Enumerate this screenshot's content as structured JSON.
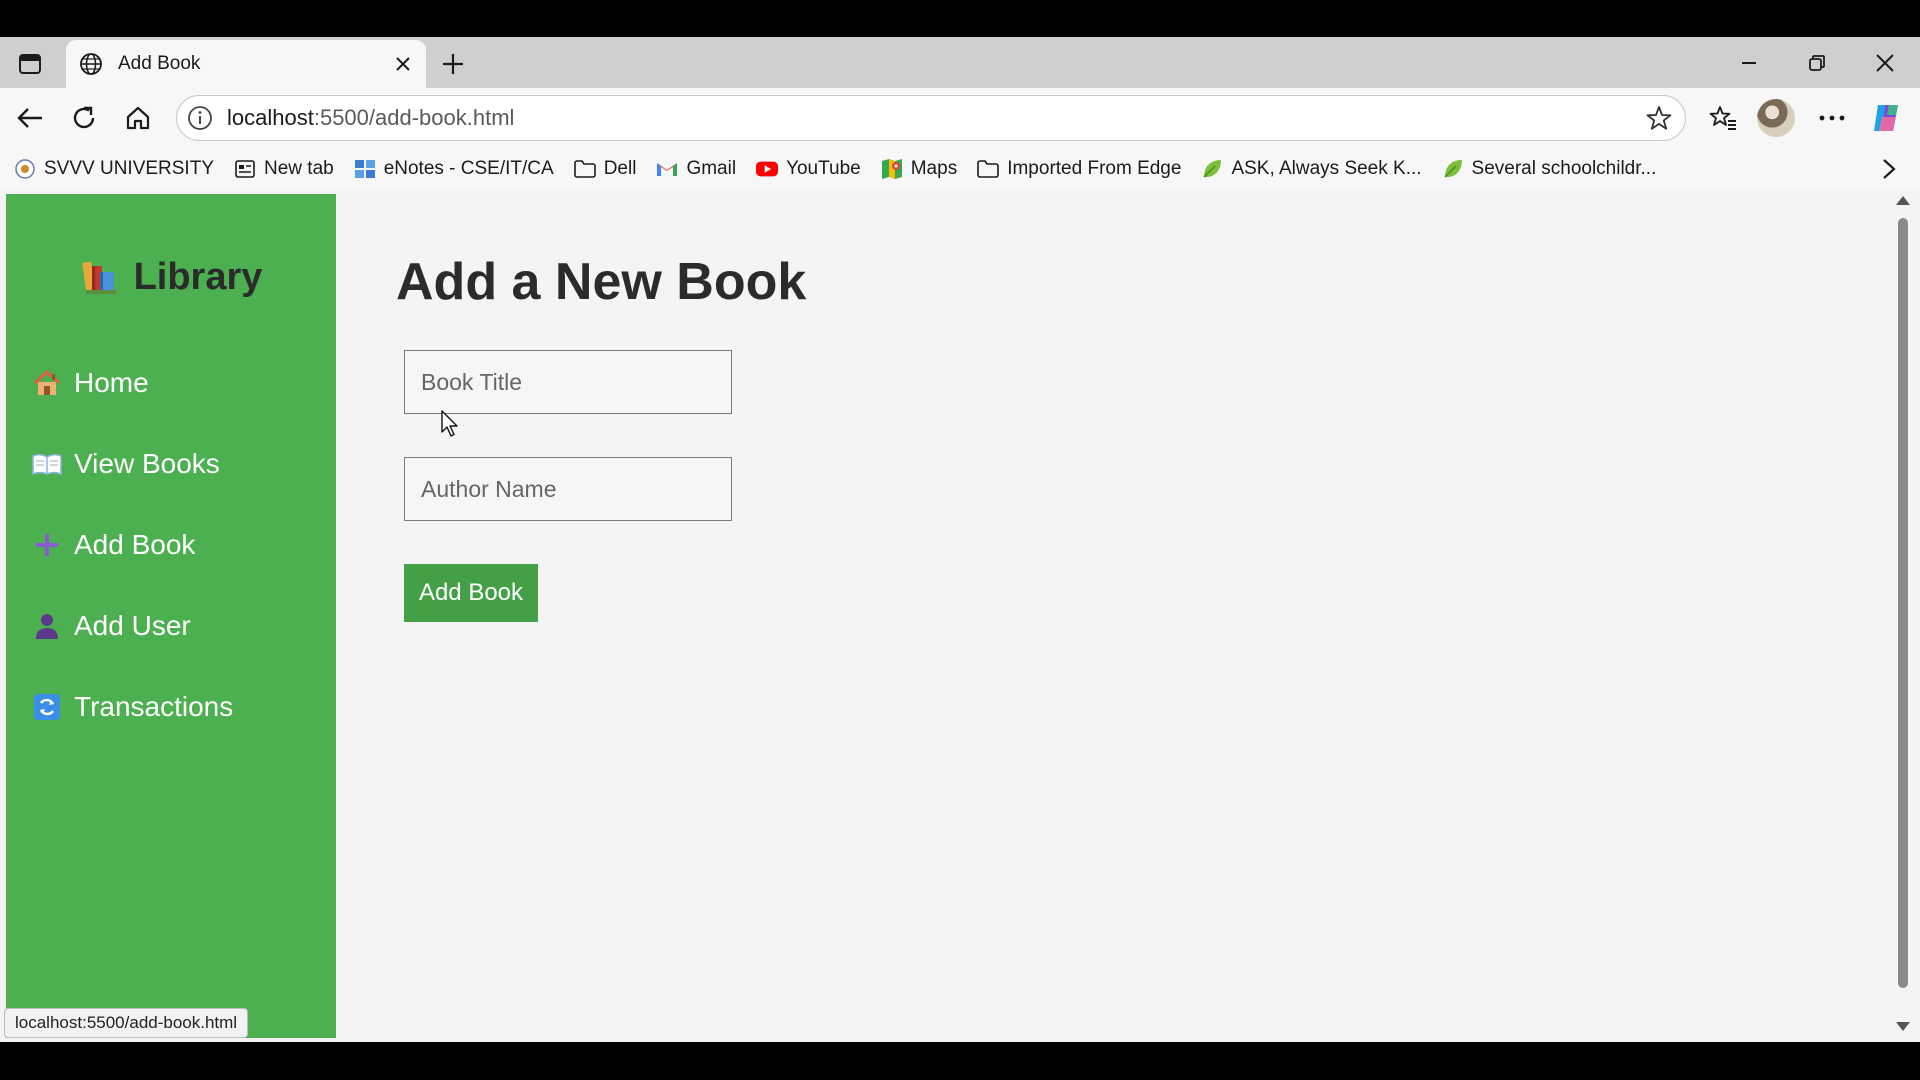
{
  "browser": {
    "tab_title": "Add Book",
    "url_host": "localhost",
    "url_rest": ":5500/add-book.html",
    "bookmarks": [
      {
        "label": "SVVV UNIVERSITY",
        "icon": "university-icon"
      },
      {
        "label": "New tab",
        "icon": "newtab-icon"
      },
      {
        "label": "eNotes - CSE/IT/CA",
        "icon": "enotes-icon"
      },
      {
        "label": "Dell",
        "icon": "folder-icon"
      },
      {
        "label": "Gmail",
        "icon": "gmail-icon"
      },
      {
        "label": "YouTube",
        "icon": "youtube-icon"
      },
      {
        "label": "Maps",
        "icon": "maps-icon"
      },
      {
        "label": "Imported From Edge",
        "icon": "folder-icon"
      },
      {
        "label": "ASK, Always Seek K...",
        "icon": "leaf-icon"
      },
      {
        "label": "Several schoolchildr...",
        "icon": "leaf-icon"
      }
    ],
    "status_url": "localhost:5500/add-book.html"
  },
  "sidebar": {
    "brand": "Library",
    "items": [
      {
        "label": "Home",
        "icon": "house-icon"
      },
      {
        "label": "View Books",
        "icon": "open-book-icon"
      },
      {
        "label": "Add Book",
        "icon": "plus-icon"
      },
      {
        "label": "Add User",
        "icon": "user-icon"
      },
      {
        "label": "Transactions",
        "icon": "refresh-icon"
      }
    ]
  },
  "main": {
    "title": "Add a New Book",
    "title_placeholder": "Book Title",
    "author_placeholder": "Author Name",
    "submit_label": "Add Book"
  },
  "colors": {
    "sidebar": "#4caf50",
    "button": "#43a047",
    "page_bg": "#f4f4f4"
  }
}
